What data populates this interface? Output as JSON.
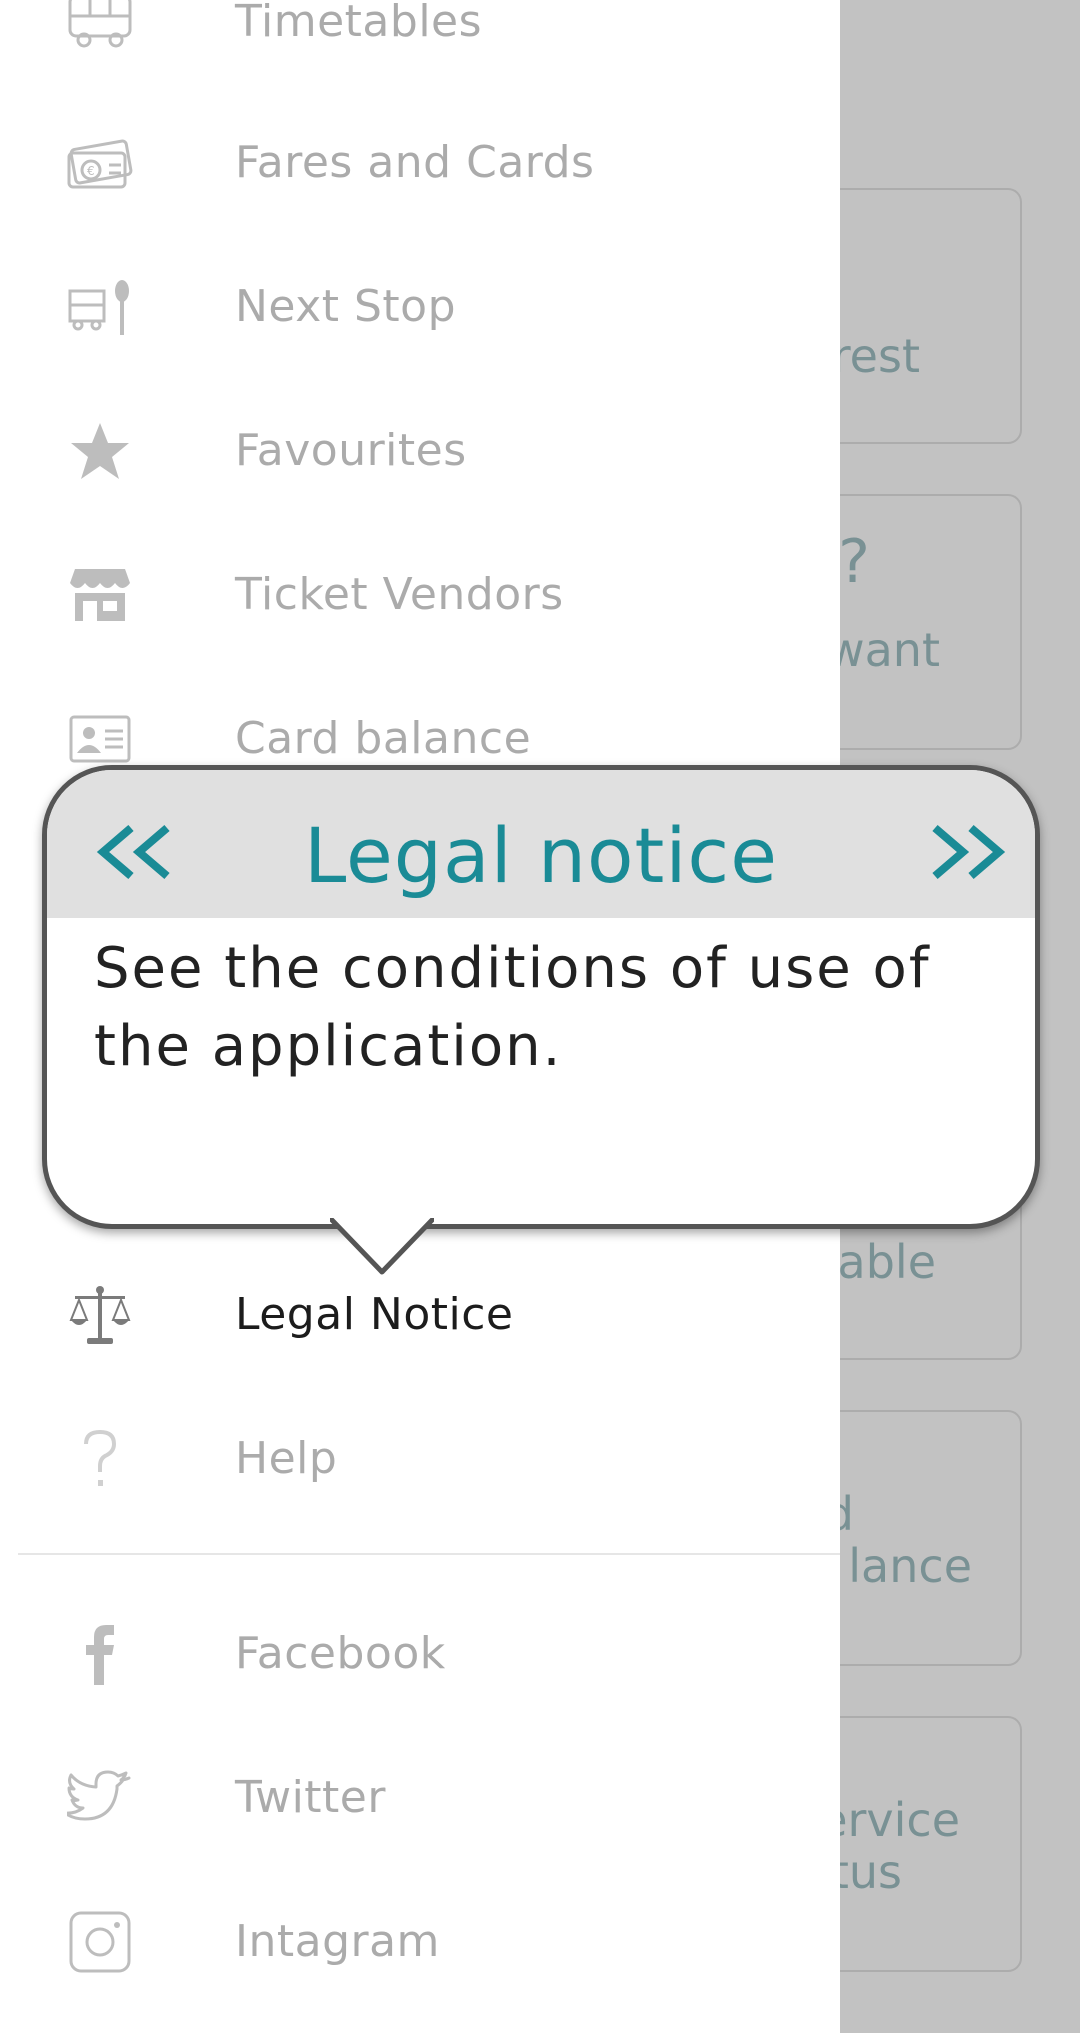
{
  "menu": {
    "items": [
      {
        "label": "Timetables",
        "icon": "bus-icon"
      },
      {
        "label": "Fares and Cards",
        "icon": "money-icon"
      },
      {
        "label": "Next Stop",
        "icon": "bus-stop-icon"
      },
      {
        "label": "Favourites",
        "icon": "star-icon"
      },
      {
        "label": "Ticket Vendors",
        "icon": "store-icon"
      },
      {
        "label": "Card balance",
        "icon": "id-card-icon"
      },
      {
        "label": "Legal Notice",
        "icon": "scales-icon"
      },
      {
        "label": "Help",
        "icon": "question-icon"
      }
    ],
    "social": [
      {
        "label": "Facebook",
        "icon": "facebook-icon"
      },
      {
        "label": "Twitter",
        "icon": "twitter-icon"
      },
      {
        "label": "Intagram",
        "icon": "instagram-icon"
      }
    ],
    "active_label": "Legal Notice"
  },
  "tooltip": {
    "title": "Legal notice",
    "body": "See the conditions of use of the application.",
    "prev_glyph": "<<",
    "next_glyph": ">>"
  },
  "background": {
    "card_fragments": [
      {
        "line1": "rest",
        "line2": ""
      },
      {
        "line1": "?",
        "line2": "want"
      },
      {
        "line1": "able",
        "line2": ""
      },
      {
        "line1": "rd",
        "line2": "lance"
      },
      {
        "line1": "ervice",
        "line2": "atus"
      }
    ]
  },
  "colors": {
    "accent": "#1a8b96",
    "menu_text": "#ababab",
    "active_text": "#1c1c1c",
    "overlay": "#c4c4c4",
    "tooltip_header": "#e0e0e0",
    "tooltip_border": "#555555"
  }
}
